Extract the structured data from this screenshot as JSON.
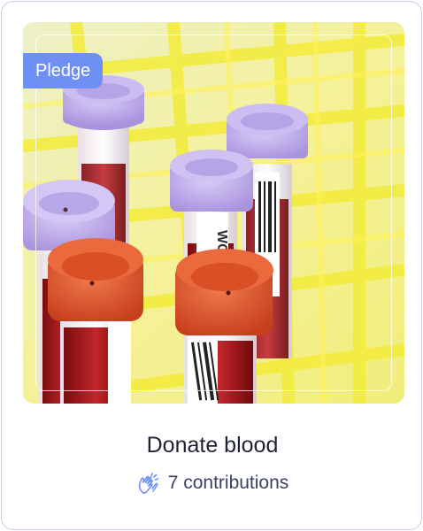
{
  "card": {
    "badge": "Pledge",
    "title": "Donate blood",
    "contributions": "7 contributions",
    "image_icon": "blood-sample-tubes-image",
    "contribution_icon": "clapping-hands-icon"
  },
  "colors": {
    "badge_bg": "#6f8ff5",
    "border": "#c7cde6",
    "title": "#1f2235",
    "meta_text": "#3a3f66",
    "rack_yellow": "#f2ea2f",
    "cap_purple": "#b9a8e8",
    "cap_orange": "#e2522a"
  }
}
